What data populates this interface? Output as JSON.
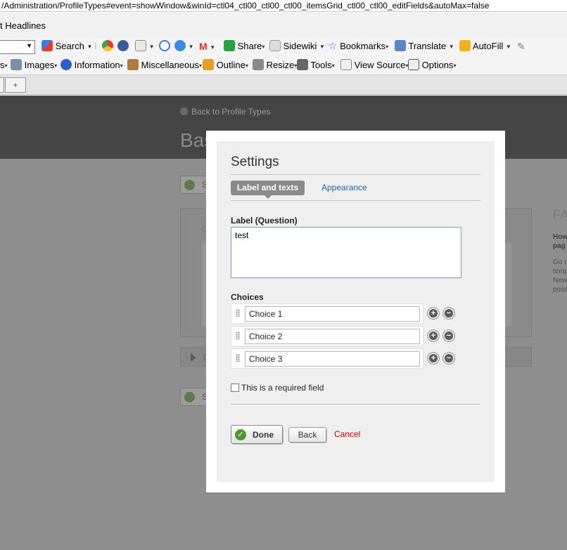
{
  "browser": {
    "url": "/Administration/ProfileTypes#event=showWindow&winId=ctl04_ctl00_ctl00_ctl00_itemsGrid_ctl00_ctl00_editFields&autoMax=false",
    "headlines": "t Headlines",
    "toolbar1": {
      "search": "Search",
      "share": "Share",
      "sidewiki": "Sidewiki",
      "bookmarks": "Bookmarks",
      "translate": "Translate",
      "autofill": "AutoFill"
    },
    "toolbar2": {
      "css": "s",
      "images": "Images",
      "information": "Information",
      "miscellaneous": "Miscellaneous",
      "outline": "Outline",
      "resize": "Resize",
      "tools": "Tools",
      "view_source": "View Source",
      "options": "Options"
    },
    "new_tab": "+"
  },
  "background": {
    "back_link": "Back to Profile Types",
    "title": "Bas",
    "save_stub": "S",
    "panel_stub": "C",
    "row_stub": "D",
    "faq_title": "FA",
    "faq_bold": [
      "How",
      "pag"
    ],
    "faq_text": [
      "Go t",
      "temp",
      "New",
      "poss"
    ]
  },
  "dialog": {
    "title": "Settings",
    "tabs": [
      {
        "label": "Label and texts",
        "active": true
      },
      {
        "label": "Appearance",
        "active": false
      }
    ],
    "label_field": {
      "label": "Label (Question)",
      "value": "test"
    },
    "choices_label": "Choices",
    "choices": [
      "Choice 1",
      "Choice 2",
      "Choice 3"
    ],
    "add_symbol": "+",
    "remove_symbol": "−",
    "required_label": "This is a required field",
    "required_checked": false,
    "buttons": {
      "done": "Done",
      "back": "Back",
      "cancel": "Cancel"
    }
  },
  "colors": {
    "accent_link": "#2b5fa8",
    "cancel": "#c00000",
    "done_check": "#4c9a2a",
    "overlay": "#8e8e8e"
  }
}
